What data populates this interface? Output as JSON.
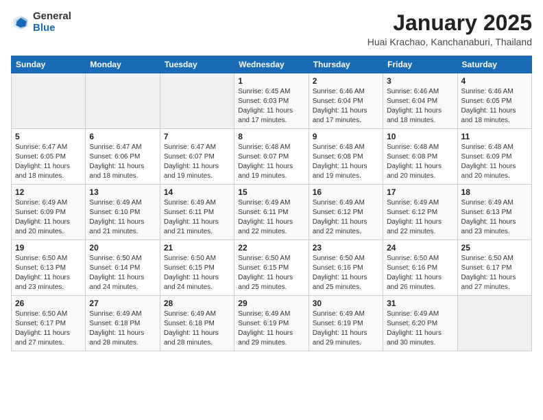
{
  "header": {
    "logo_general": "General",
    "logo_blue": "Blue",
    "month_title": "January 2025",
    "location": "Huai Krachao, Kanchanaburi, Thailand"
  },
  "weekdays": [
    "Sunday",
    "Monday",
    "Tuesday",
    "Wednesday",
    "Thursday",
    "Friday",
    "Saturday"
  ],
  "weeks": [
    [
      {
        "day": "",
        "info": ""
      },
      {
        "day": "",
        "info": ""
      },
      {
        "day": "",
        "info": ""
      },
      {
        "day": "1",
        "info": "Sunrise: 6:45 AM\nSunset: 6:03 PM\nDaylight: 11 hours and 17 minutes."
      },
      {
        "day": "2",
        "info": "Sunrise: 6:46 AM\nSunset: 6:04 PM\nDaylight: 11 hours and 17 minutes."
      },
      {
        "day": "3",
        "info": "Sunrise: 6:46 AM\nSunset: 6:04 PM\nDaylight: 11 hours and 18 minutes."
      },
      {
        "day": "4",
        "info": "Sunrise: 6:46 AM\nSunset: 6:05 PM\nDaylight: 11 hours and 18 minutes."
      }
    ],
    [
      {
        "day": "5",
        "info": "Sunrise: 6:47 AM\nSunset: 6:05 PM\nDaylight: 11 hours and 18 minutes."
      },
      {
        "day": "6",
        "info": "Sunrise: 6:47 AM\nSunset: 6:06 PM\nDaylight: 11 hours and 18 minutes."
      },
      {
        "day": "7",
        "info": "Sunrise: 6:47 AM\nSunset: 6:07 PM\nDaylight: 11 hours and 19 minutes."
      },
      {
        "day": "8",
        "info": "Sunrise: 6:48 AM\nSunset: 6:07 PM\nDaylight: 11 hours and 19 minutes."
      },
      {
        "day": "9",
        "info": "Sunrise: 6:48 AM\nSunset: 6:08 PM\nDaylight: 11 hours and 19 minutes."
      },
      {
        "day": "10",
        "info": "Sunrise: 6:48 AM\nSunset: 6:08 PM\nDaylight: 11 hours and 20 minutes."
      },
      {
        "day": "11",
        "info": "Sunrise: 6:48 AM\nSunset: 6:09 PM\nDaylight: 11 hours and 20 minutes."
      }
    ],
    [
      {
        "day": "12",
        "info": "Sunrise: 6:49 AM\nSunset: 6:09 PM\nDaylight: 11 hours and 20 minutes."
      },
      {
        "day": "13",
        "info": "Sunrise: 6:49 AM\nSunset: 6:10 PM\nDaylight: 11 hours and 21 minutes."
      },
      {
        "day": "14",
        "info": "Sunrise: 6:49 AM\nSunset: 6:11 PM\nDaylight: 11 hours and 21 minutes."
      },
      {
        "day": "15",
        "info": "Sunrise: 6:49 AM\nSunset: 6:11 PM\nDaylight: 11 hours and 22 minutes."
      },
      {
        "day": "16",
        "info": "Sunrise: 6:49 AM\nSunset: 6:12 PM\nDaylight: 11 hours and 22 minutes."
      },
      {
        "day": "17",
        "info": "Sunrise: 6:49 AM\nSunset: 6:12 PM\nDaylight: 11 hours and 22 minutes."
      },
      {
        "day": "18",
        "info": "Sunrise: 6:49 AM\nSunset: 6:13 PM\nDaylight: 11 hours and 23 minutes."
      }
    ],
    [
      {
        "day": "19",
        "info": "Sunrise: 6:50 AM\nSunset: 6:13 PM\nDaylight: 11 hours and 23 minutes."
      },
      {
        "day": "20",
        "info": "Sunrise: 6:50 AM\nSunset: 6:14 PM\nDaylight: 11 hours and 24 minutes."
      },
      {
        "day": "21",
        "info": "Sunrise: 6:50 AM\nSunset: 6:15 PM\nDaylight: 11 hours and 24 minutes."
      },
      {
        "day": "22",
        "info": "Sunrise: 6:50 AM\nSunset: 6:15 PM\nDaylight: 11 hours and 25 minutes."
      },
      {
        "day": "23",
        "info": "Sunrise: 6:50 AM\nSunset: 6:16 PM\nDaylight: 11 hours and 25 minutes."
      },
      {
        "day": "24",
        "info": "Sunrise: 6:50 AM\nSunset: 6:16 PM\nDaylight: 11 hours and 26 minutes."
      },
      {
        "day": "25",
        "info": "Sunrise: 6:50 AM\nSunset: 6:17 PM\nDaylight: 11 hours and 27 minutes."
      }
    ],
    [
      {
        "day": "26",
        "info": "Sunrise: 6:50 AM\nSunset: 6:17 PM\nDaylight: 11 hours and 27 minutes."
      },
      {
        "day": "27",
        "info": "Sunrise: 6:49 AM\nSunset: 6:18 PM\nDaylight: 11 hours and 28 minutes."
      },
      {
        "day": "28",
        "info": "Sunrise: 6:49 AM\nSunset: 6:18 PM\nDaylight: 11 hours and 28 minutes."
      },
      {
        "day": "29",
        "info": "Sunrise: 6:49 AM\nSunset: 6:19 PM\nDaylight: 11 hours and 29 minutes."
      },
      {
        "day": "30",
        "info": "Sunrise: 6:49 AM\nSunset: 6:19 PM\nDaylight: 11 hours and 29 minutes."
      },
      {
        "day": "31",
        "info": "Sunrise: 6:49 AM\nSunset: 6:20 PM\nDaylight: 11 hours and 30 minutes."
      },
      {
        "day": "",
        "info": ""
      }
    ]
  ]
}
